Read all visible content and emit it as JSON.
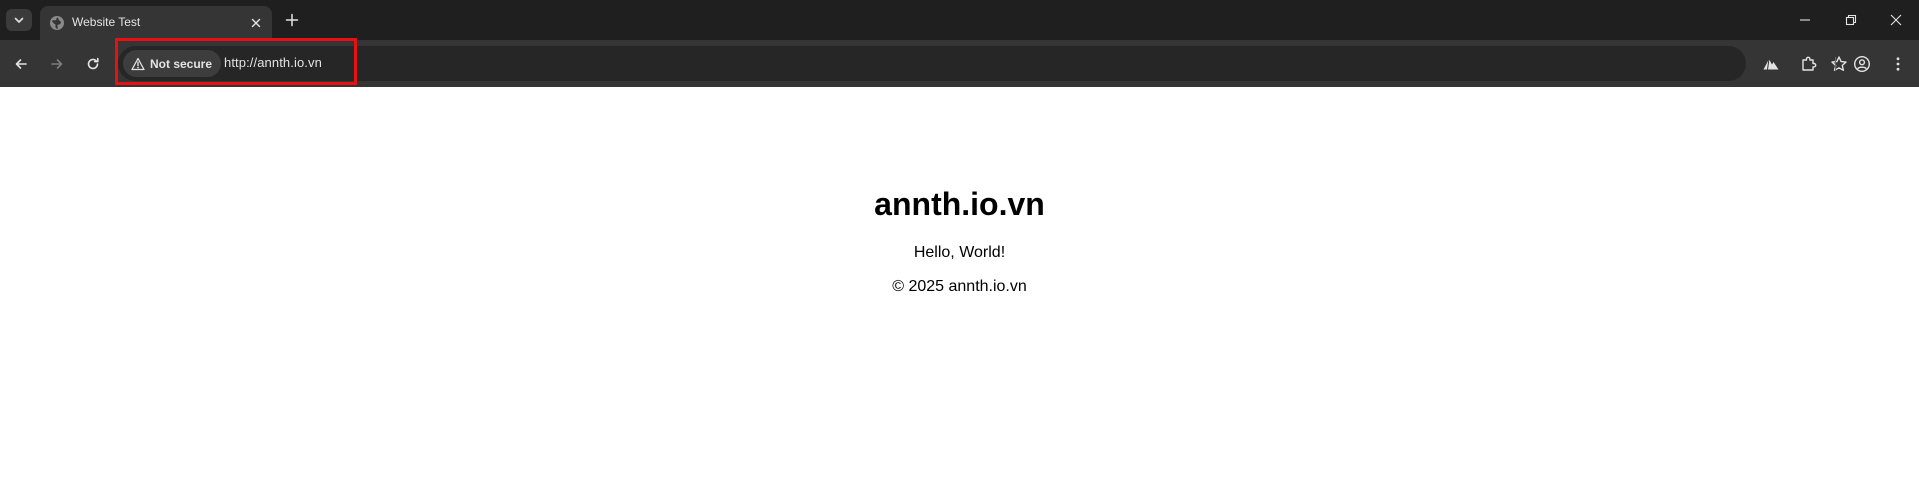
{
  "browser": {
    "tab": {
      "title": "Website Test",
      "favicon": "globe-icon"
    },
    "omnibox": {
      "security_label": "Not secure",
      "url": "http://annth.io.vn"
    },
    "icons": {
      "tab_search": "chevron-down-icon",
      "close_tab": "close-icon",
      "new_tab": "plus-icon",
      "minimize": "minimize-icon",
      "restore": "restore-icon",
      "close_window": "close-icon",
      "back": "back-arrow-icon",
      "forward": "forward-arrow-icon",
      "reload": "reload-icon",
      "bookmark": "star-icon",
      "extension_1": "mountain-extension-icon",
      "extensions": "puzzle-icon",
      "profile": "profile-icon",
      "menu": "kebab-menu-icon"
    },
    "colors": {
      "tabstrip": "#1f1f1f",
      "toolbar": "#353535",
      "omnibox": "#262626",
      "highlight": "#e81010"
    }
  },
  "page": {
    "title": "annth.io.vn",
    "message": "Hello, World!",
    "footer": "© 2025 annth.io.vn"
  }
}
